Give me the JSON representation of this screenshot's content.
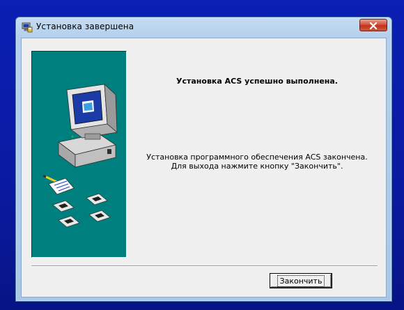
{
  "window": {
    "title": "Установка завершена",
    "app_icon": "setup-icon",
    "close_icon": "close-icon"
  },
  "side_panel": {
    "background": "#007f7f",
    "illustration": "computer-with-disks-illustration"
  },
  "main": {
    "heading": "Установка ACS успешно выполнена.",
    "message_line1": "Установка программного обеспечения ACS закончена.",
    "message_line2": "Для выхода  нажмите кнопку \"Закончить\"."
  },
  "buttons": {
    "finish_label": "Закончить"
  },
  "colors": {
    "desktop": "#0a1fb4",
    "dialog_bg": "#f0f0f0",
    "close_button": "#c0321c"
  }
}
